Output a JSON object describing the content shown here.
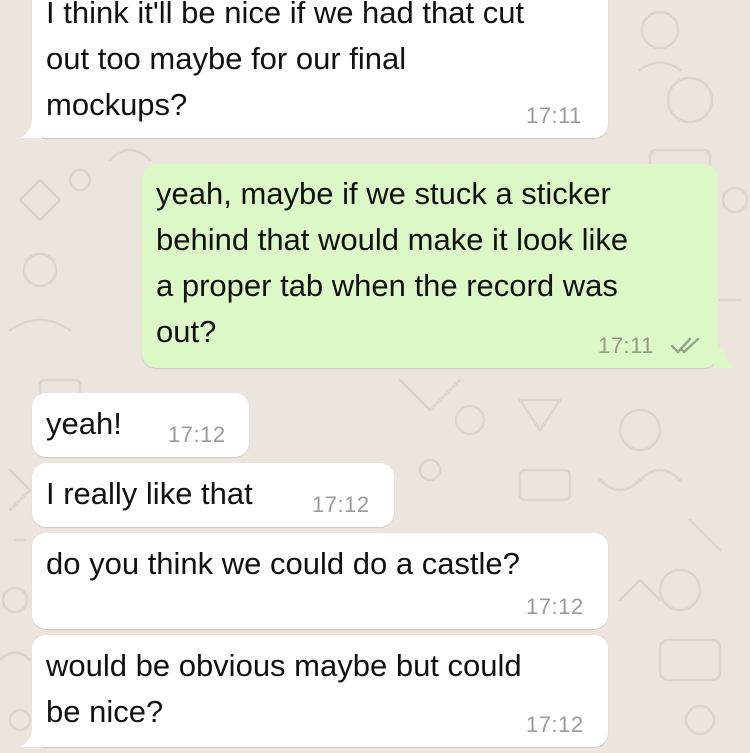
{
  "messages": [
    {
      "side": "in",
      "text": "I think it'll be nice if we had that cut\nout too maybe for our final\nmockups?",
      "time": "17:11"
    },
    {
      "side": "out",
      "text": "yeah, maybe if we stuck a sticker\nbehind that would make it look like\na proper tab when the record was\nout?",
      "time": "17:11",
      "status": "read-double-check-icon"
    },
    {
      "side": "in",
      "text": "yeah!",
      "time": "17:12"
    },
    {
      "side": "in",
      "text": "I really like that",
      "time": "17:12"
    },
    {
      "side": "in",
      "text": "do you think we could do a castle?",
      "time": "17:12"
    },
    {
      "side": "in",
      "text": "would be obvious maybe but could\nbe nice?",
      "time": "17:12"
    }
  ],
  "colors": {
    "background": "#ECE5DD",
    "incoming_bubble": "#FFFFFF",
    "outgoing_bubble": "#DCF8C6",
    "timestamp": "#9A9A9A"
  }
}
